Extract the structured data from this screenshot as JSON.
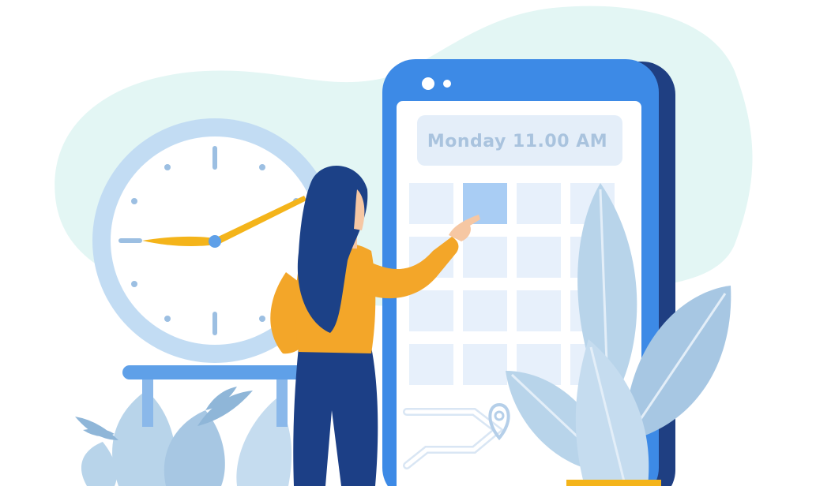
{
  "phone": {
    "banner_text": "Monday 11.00 AM"
  },
  "calendar": {
    "rows": 4,
    "cols": 4,
    "highlighted_cell": {
      "row": 0,
      "col": 1
    }
  },
  "colors": {
    "background_blob": "#e3f6f4",
    "phone_frame": "#3d8ae6",
    "phone_shadow": "#1f3f82",
    "screen": "#ffffff",
    "grid_cell": "#e7f0fb",
    "grid_cell_active": "#a9cdf4",
    "banner": "#e4eef9",
    "clock_ring": "#c2dcf3",
    "clock_face": "#ffffff",
    "clock_hands": "#f4b41a",
    "shirt": "#f3a629",
    "hair": "#1c4187",
    "pants": "#1c3f86",
    "leaf_light": "#b8d4ea",
    "leaf_dark": "#8fb6d8"
  },
  "icons": [
    "clock-icon",
    "map-pin-icon",
    "camera-dot-icon"
  ]
}
